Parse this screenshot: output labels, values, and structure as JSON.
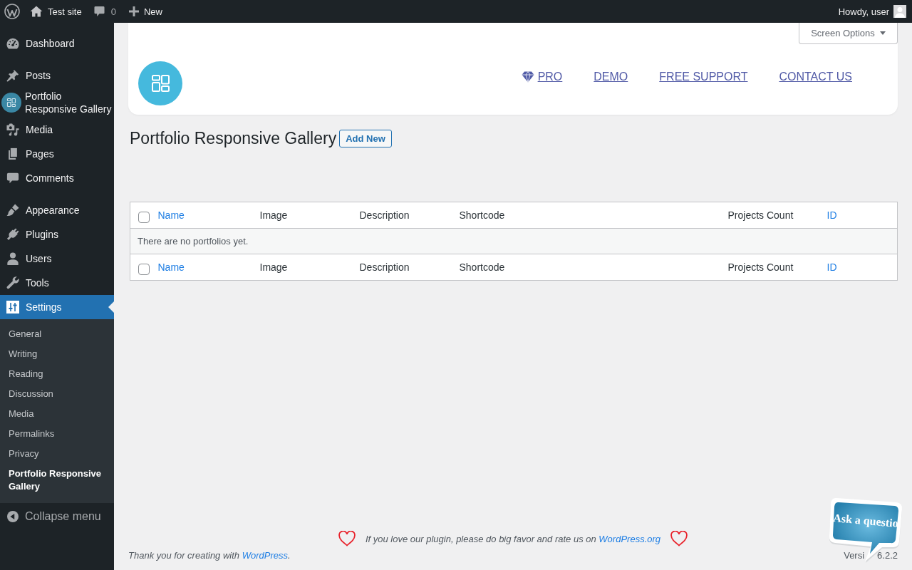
{
  "admin_bar": {
    "site_name": "Test site",
    "comments_count": "0",
    "new_label": "New",
    "greeting": "Howdy, user"
  },
  "sidebar": {
    "groups": [
      {
        "items": [
          {
            "label": "Dashboard",
            "selected": false
          }
        ]
      },
      {
        "items": [
          {
            "label": "Posts",
            "selected": false
          },
          {
            "label": "Portfolio Responsive Gallery",
            "selected": false
          },
          {
            "label": "Media",
            "selected": false
          },
          {
            "label": "Pages",
            "selected": false
          },
          {
            "label": "Comments",
            "selected": false
          }
        ]
      },
      {
        "items": [
          {
            "label": "Appearance",
            "selected": false
          },
          {
            "label": "Plugins",
            "selected": false
          },
          {
            "label": "Users",
            "selected": false
          },
          {
            "label": "Tools",
            "selected": false
          },
          {
            "label": "Settings",
            "selected": true,
            "children": [
              {
                "label": "General",
                "selected": false
              },
              {
                "label": "Writing",
                "selected": false
              },
              {
                "label": "Reading",
                "selected": false
              },
              {
                "label": "Discussion",
                "selected": false
              },
              {
                "label": "Media",
                "selected": false
              },
              {
                "label": "Permalinks",
                "selected": false
              },
              {
                "label": "Privacy",
                "selected": false
              },
              {
                "label": "Portfolio Responsive Gallery",
                "selected": true
              }
            ]
          }
        ]
      }
    ],
    "collapse_label": "Collapse menu"
  },
  "screen_options": {
    "label": "Screen Options",
    "expanded": false
  },
  "header_card": {
    "links": [
      {
        "kind": "featured",
        "label": "PRO"
      },
      {
        "kind": "plain",
        "label": "DEMO"
      },
      {
        "kind": "plain",
        "label": "FREE SUPPORT"
      },
      {
        "kind": "plain",
        "label": "CONTACT US"
      }
    ]
  },
  "page": {
    "title": "Portfolio Responsive Gallery",
    "add_new": "Add New"
  },
  "table": {
    "header": {
      "select_all": {
        "checked": false
      },
      "columns": [
        {
          "label": "Name",
          "sortable": true
        },
        {
          "label": "Image",
          "sortable": false
        },
        {
          "label": "Description",
          "sortable": false
        },
        {
          "label": "Shortcode",
          "sortable": false
        },
        {
          "label": "Projects Count",
          "sortable": false
        },
        {
          "label": "ID",
          "sortable": true
        }
      ]
    },
    "empty_message": "There are no portfolios yet.",
    "footer": {
      "select_all": {
        "checked": false
      },
      "columns": [
        {
          "label": "Name",
          "sortable": true
        },
        {
          "label": "Image",
          "sortable": false
        },
        {
          "label": "Description",
          "sortable": false
        },
        {
          "label": "Shortcode",
          "sortable": false
        },
        {
          "label": "Projects Count",
          "sortable": false
        },
        {
          "label": "ID",
          "sortable": true
        }
      ]
    }
  },
  "footer": {
    "rating_text": "If you love our plugin, please do big favor and rate us on",
    "rating_link": "WordPress.org",
    "thanks_text": "Thank you for creating with",
    "thanks_link": "WordPress",
    "thanks_end": ".",
    "version_text": [
      "Versi",
      "6.2.2"
    ]
  },
  "help_bubble": {
    "label": "Ask a questio"
  }
}
